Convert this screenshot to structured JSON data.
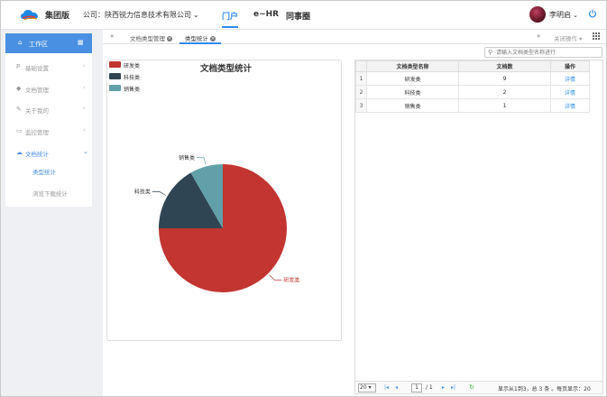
{
  "header": {
    "app_name": "集团版",
    "company_label": "公司：陕西锐力信息技术有限公司",
    "nav": [
      "门户",
      "e~HR",
      "同事圈"
    ],
    "active_nav": "门户",
    "user_name": "李明启",
    "logo_icon": "cloud-logo-icon",
    "power_icon": "power-icon"
  },
  "sidebar": {
    "workspace_label": "工作区",
    "items": [
      {
        "label": "基础设置",
        "icon": "P"
      },
      {
        "label": "文档管理",
        "icon": "◆"
      },
      {
        "label": "关于我的",
        "icon": "✎"
      },
      {
        "label": "监控管理",
        "icon": "▭"
      },
      {
        "label": "文档统计",
        "icon": "☁"
      }
    ],
    "sub_items": [
      "类型统计",
      "浏览下载统计"
    ],
    "active_sub": "类型统计"
  },
  "tabs": {
    "items": [
      "文档类型管理",
      "类型统计"
    ],
    "active": "类型统计",
    "close_ops_label": "关闭操作"
  },
  "search": {
    "placeholder": "请输入文档类型名称进行"
  },
  "chart_data": {
    "type": "pie",
    "title": "文档类型统计",
    "categories": [
      "研发类",
      "科技类",
      "销售类"
    ],
    "values": [
      9,
      2,
      1
    ],
    "colors": [
      "#c23531",
      "#2f4554",
      "#61a0a8"
    ],
    "legend_position": "top-left"
  },
  "table": {
    "headers": [
      "文档类型名称",
      "文档数",
      "操作"
    ],
    "rows": [
      {
        "index": "1",
        "name": "研发类",
        "count": "9",
        "action": "详情"
      },
      {
        "index": "2",
        "name": "科技类",
        "count": "2",
        "action": "详情"
      },
      {
        "index": "3",
        "name": "销售类",
        "count": "1",
        "action": "详情"
      }
    ]
  },
  "pager": {
    "page_size": "20",
    "current_page": "1",
    "total_pages": "/ 1",
    "info": "显示从1到3，总 3 条 。每页显示：20"
  }
}
